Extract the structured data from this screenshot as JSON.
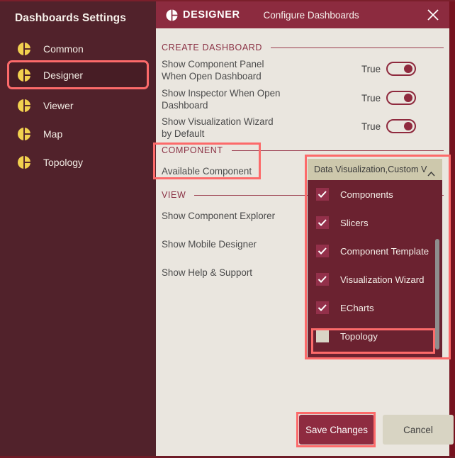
{
  "sidebar": {
    "title": "Dashboards Settings",
    "items": [
      {
        "label": "Common",
        "icon": "pie-chart-icon",
        "selected": false
      },
      {
        "label": "Designer",
        "icon": "pie-chart-icon",
        "selected": true
      },
      {
        "label": "Viewer",
        "icon": "pie-chart-icon",
        "selected": false
      },
      {
        "label": "Map",
        "icon": "pie-chart-icon",
        "selected": false
      },
      {
        "label": "Topology",
        "icon": "pie-chart-icon",
        "selected": false
      }
    ]
  },
  "titlebar": {
    "logo_icon": "designer-logo-icon",
    "logo_text": "DESIGNER",
    "subtitle": "Configure Dashboards",
    "close_icon": "close-icon"
  },
  "sections": {
    "create_dashboard": {
      "header": "CREATE DASHBOARD",
      "rows": [
        {
          "label": "Show Component Panel\nWhen Open Dashboard",
          "value": "True",
          "state": "on"
        },
        {
          "label": "Show Inspector When Open\nDashboard",
          "value": "True",
          "state": "on"
        },
        {
          "label": "Show Visualization Wizard\nby Default",
          "value": "True",
          "state": "on"
        }
      ]
    },
    "component": {
      "header": "COMPONENT",
      "row_label": "Available Component"
    },
    "view": {
      "header": "VIEW",
      "rows": [
        {
          "label": "Show Component Explorer"
        },
        {
          "label": "Show Mobile Designer"
        },
        {
          "label": "Show Help & Support"
        }
      ]
    }
  },
  "dropdown": {
    "selected_text": "Data Visualization,Custom Vis...",
    "chevron_icon": "chevron-up-icon",
    "expanded": true,
    "options": [
      {
        "label": "Components",
        "checked": true
      },
      {
        "label": "Slicers",
        "checked": true
      },
      {
        "label": "Component Template",
        "checked": true
      },
      {
        "label": "Visualization Wizard",
        "checked": true
      },
      {
        "label": "ECharts",
        "checked": true
      },
      {
        "label": "Topology",
        "checked": false
      }
    ]
  },
  "footer": {
    "save_label": "Save Changes",
    "cancel_label": "Cancel"
  },
  "colors": {
    "sidebar_bg": "#51222b",
    "titlebar_bg": "#8c2b3f",
    "panel_bg": "#eae6df",
    "accent": "#8e2b40",
    "highlight": "#fc6a6a",
    "dropdown_header": "#cdc8ac",
    "dropdown_list": "#6b2230",
    "icon_yellow": "#f2d14f"
  }
}
